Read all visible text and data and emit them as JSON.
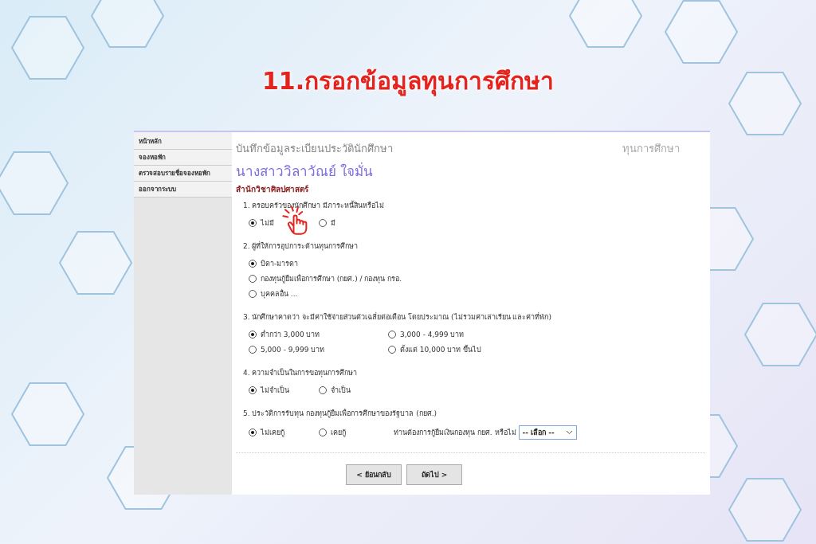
{
  "slide_title": "11.กรอกข้อมูลทุนการศึกษา",
  "sidebar": {
    "items": [
      {
        "label": "หน้าหลัก"
      },
      {
        "label": "จองหอพัก"
      },
      {
        "label": "ตรวจสอบรายชื่อจองหอพัก"
      },
      {
        "label": "ออกจากระบบ"
      }
    ]
  },
  "header": {
    "title": "บันทึกข้อมูลระเบียนประวัตินักศึกษา",
    "section": "ทุนการศึกษา"
  },
  "student_name": "นางสาววิลาวัณย์ ใจมั่น",
  "faculty": "สำนักวิชาศิลปศาสตร์",
  "questions": [
    {
      "label": "1. ครอบครัวของนักศึกษา มีภาระหนี้สินหรือไม่",
      "kind": "row",
      "options": [
        {
          "label": "ไม่มี",
          "selected": true
        },
        {
          "label": "มี",
          "selected": false
        }
      ]
    },
    {
      "label": "2. ผู้ที่ให้การอุปการะด้านทุนการศึกษา",
      "kind": "column",
      "options": [
        {
          "label": "บิดา-มารดา",
          "selected": true
        },
        {
          "label": "กองทุนกู้ยืมเพื่อการศึกษา (กยศ.) / กองทุน กรอ.",
          "selected": false
        },
        {
          "label": "บุคคลอื่น ...",
          "selected": false
        }
      ]
    },
    {
      "label": "3. นักศึกษาคาดว่า จะมีค่าใช้จ่ายส่วนตัวเฉลี่ยต่อเดือน โดยประมาณ (ไม่รวมค่าเล่าเรียน และค่าที่พัก)",
      "kind": "grid",
      "options": [
        {
          "label": "ต่ำกว่า 3,000 บาท",
          "selected": true
        },
        {
          "label": "3,000 - 4,999 บาท",
          "selected": false
        },
        {
          "label": "5,000 - 9,999 บาท",
          "selected": false
        },
        {
          "label": "ตั้งแต่ 10,000 บาท ขึ้นไป",
          "selected": false
        }
      ]
    },
    {
      "label": "4. ความจำเป็นในการขอทุนการศึกษา",
      "kind": "row",
      "options": [
        {
          "label": "ไม่จำเป็น",
          "selected": true
        },
        {
          "label": "จำเป็น",
          "selected": false
        }
      ]
    },
    {
      "label": "5. ประวัติการรับทุน กองทุนกู้ยืมเพื่อการศึกษาของรัฐบาล (กยศ.)",
      "kind": "row",
      "options": [
        {
          "label": "ไม่เคยกู้",
          "selected": true
        },
        {
          "label": "เคยกู้",
          "selected": false
        }
      ],
      "prompt": "ท่านต้องการกู้ยืมเงินกองทุน กยศ. หรือไม่",
      "select": {
        "value": "-- เลือก --"
      }
    }
  ],
  "buttons": [
    {
      "label": "< ย้อนกลับ"
    },
    {
      "label": "ถัดไป >"
    }
  ]
}
